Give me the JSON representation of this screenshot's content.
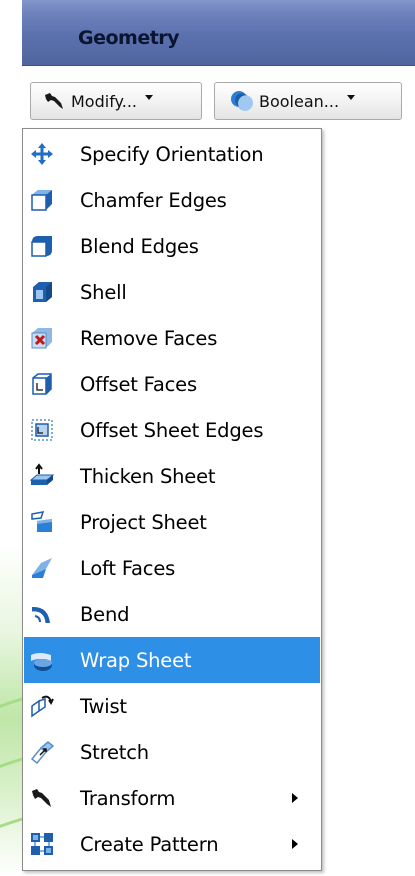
{
  "panel": {
    "title": "Geometry"
  },
  "toolbar": {
    "modify_label": "Modify...",
    "boolean_label": "Boolean..."
  },
  "menu": {
    "items": [
      {
        "label": "Specify Orientation",
        "icon": "orientation-icon"
      },
      {
        "label": "Chamfer Edges",
        "icon": "chamfer-edges-icon"
      },
      {
        "label": "Blend Edges",
        "icon": "blend-edges-icon"
      },
      {
        "label": "Shell",
        "icon": "shell-icon"
      },
      {
        "label": "Remove Faces",
        "icon": "remove-faces-icon"
      },
      {
        "label": "Offset Faces",
        "icon": "offset-faces-icon"
      },
      {
        "label": "Offset Sheet Edges",
        "icon": "offset-sheet-edges-icon"
      },
      {
        "label": "Thicken Sheet",
        "icon": "thicken-sheet-icon"
      },
      {
        "label": "Project Sheet",
        "icon": "project-sheet-icon"
      },
      {
        "label": "Loft Faces",
        "icon": "loft-faces-icon"
      },
      {
        "label": "Bend",
        "icon": "bend-icon"
      },
      {
        "label": "Wrap Sheet",
        "icon": "wrap-sheet-icon",
        "highlighted": true
      },
      {
        "label": "Twist",
        "icon": "twist-icon"
      },
      {
        "label": "Stretch",
        "icon": "stretch-icon"
      },
      {
        "label": "Transform",
        "icon": "transform-icon",
        "submenu": true
      },
      {
        "label": "Create Pattern",
        "icon": "create-pattern-icon",
        "submenu": true
      }
    ]
  },
  "colors": {
    "header": "#5b70ae",
    "highlight": "#2d8fe6",
    "icon_blue": "#1f6fc4"
  }
}
